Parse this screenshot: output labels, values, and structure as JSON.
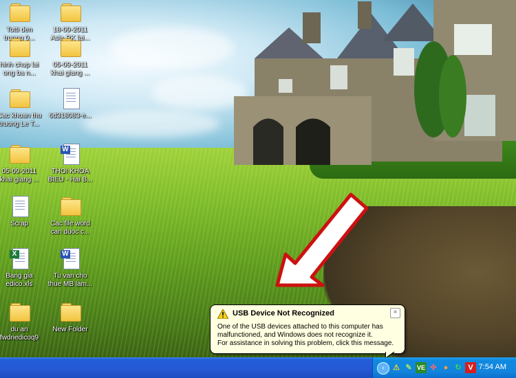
{
  "desktop": {
    "icons": [
      {
        "label": "Totti den\ntruong 0...",
        "kind": "folder"
      },
      {
        "label": "18-09-2011\nAsia RK lai...",
        "kind": "folder"
      },
      {
        "label": "hinh chup lai\nong ba n...",
        "kind": "folder"
      },
      {
        "label": "05-09-2011\nkhai giang ...",
        "kind": "folder"
      },
      {
        "label": "Cac khoan thu\ntruong Le T...",
        "kind": "folder"
      },
      {
        "label": "6d318083-e...",
        "kind": "document"
      },
      {
        "label": "05-09-2011\nkhai giang ...",
        "kind": "folder"
      },
      {
        "label": "THOI KHOA\nBIEU - Hai B...",
        "kind": "word"
      },
      {
        "label": "Scrap",
        "kind": "document"
      },
      {
        "label": "Cac file word\ncan duoc c...",
        "kind": "folder"
      },
      {
        "label": "Bang gia\nedico.xls",
        "kind": "excel"
      },
      {
        "label": "Tu van cho\nthue MB lam...",
        "kind": "word"
      },
      {
        "label": "du an\nfwdnedicoq9",
        "kind": "folder"
      },
      {
        "label": "New Folder",
        "kind": "folder"
      }
    ]
  },
  "notification": {
    "title": "USB Device Not Recognized",
    "line1": "One of the USB devices attached to this computer has",
    "line2": "malfunctioned, and Windows does not recognize it.",
    "line3": "For assistance in solving this problem, click this message.",
    "close": "×"
  },
  "taskbar": {
    "clock": "7:54 AM",
    "tray_arrow": "‹",
    "tray_icons": [
      {
        "name": "usb-warning-icon",
        "glyph": "⚠"
      },
      {
        "name": "pen-icon",
        "glyph": "✎"
      },
      {
        "name": "ve-icon",
        "glyph": "VE"
      },
      {
        "name": "network-icon",
        "glyph": "✣"
      },
      {
        "name": "shield-icon",
        "glyph": "●"
      },
      {
        "name": "sync-icon",
        "glyph": "↻"
      },
      {
        "name": "antivirus-icon",
        "glyph": "V"
      }
    ]
  },
  "colors": {
    "taskbar": "#245edb",
    "tray": "#0f8ae0",
    "balloon": "#ffffe1",
    "arrow_outline": "#cc1111"
  }
}
